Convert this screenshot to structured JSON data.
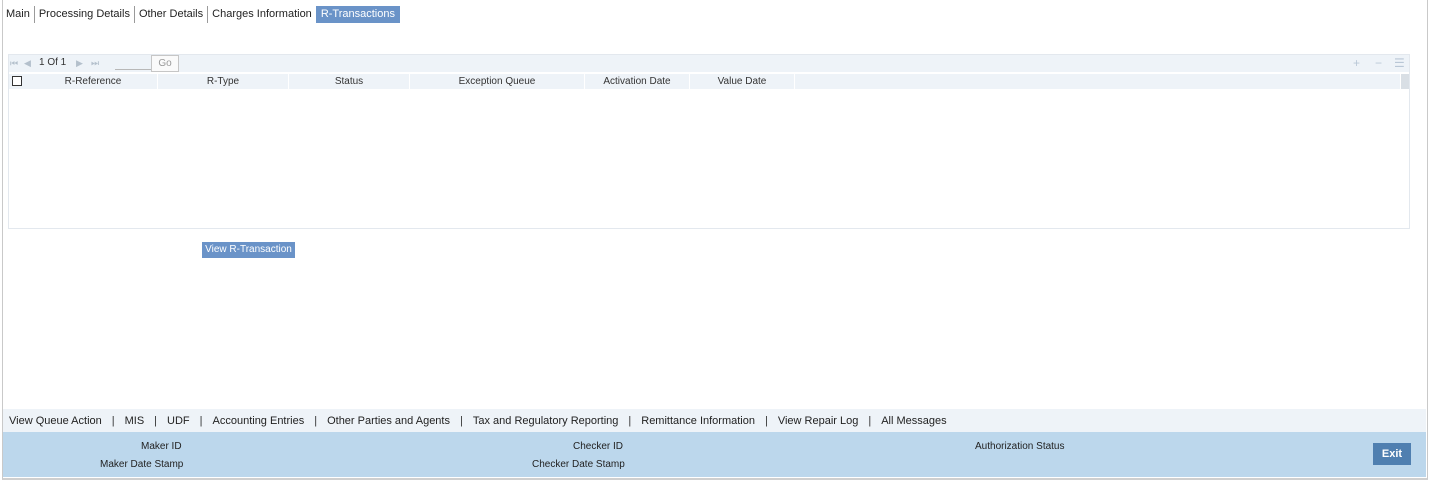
{
  "tabs": [
    {
      "label": "Main"
    },
    {
      "label": "Processing Details"
    },
    {
      "label": "Other Details"
    },
    {
      "label": "Charges Information"
    },
    {
      "label": "R-Transactions",
      "active": true
    }
  ],
  "grid": {
    "pager": {
      "page_text": "1 Of 1",
      "go_label": "Go"
    },
    "columns": [
      "R-Reference",
      "R-Type",
      "Status",
      "Exception Queue",
      "Activation Date",
      "Value Date"
    ],
    "rows": []
  },
  "view_button_label": "View R-Transaction",
  "bottom_links": [
    "View Queue Action",
    "MIS",
    "UDF",
    "Accounting Entries",
    "Other Parties and Agents",
    "Tax and Regulatory Reporting",
    "Remittance Information",
    "View Repair Log",
    "All Messages"
  ],
  "footer": {
    "maker_id": "Maker ID",
    "maker_date_stamp": "Maker Date Stamp",
    "checker_id": "Checker ID",
    "checker_date_stamp": "Checker Date Stamp",
    "authorization_status": "Authorization Status",
    "exit_label": "Exit"
  },
  "colors": {
    "accent": "#6a93c8",
    "footer_bg": "#bcd7ec",
    "exit_bg": "#4f7fb0"
  }
}
